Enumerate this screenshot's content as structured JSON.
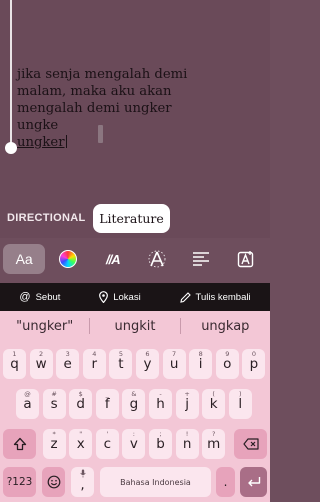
{
  "story": {
    "line1": "jika senja mengalah demi",
    "line2": "malam, maka aku akan",
    "line3": "mengalah demi ungker ungke",
    "line4": "ungker"
  },
  "styles": {
    "directional": "DIRECTIONAL",
    "literature": "Literature"
  },
  "toolbar": {
    "font_label": "Aa",
    "italic_label": "//A",
    "icons": [
      "font-icon",
      "color-wheel-icon",
      "italic-effect-icon",
      "animate-icon",
      "align-icon",
      "sticker-text-icon"
    ]
  },
  "mentions": {
    "mention": "Sebut",
    "location": "Lokasi",
    "rewrite": "Tulis kembali"
  },
  "keyboard": {
    "suggestions": [
      "\"ungker\"",
      "ungkit",
      "ungkap"
    ],
    "row1": [
      "q",
      "w",
      "e",
      "r",
      "t",
      "y",
      "u",
      "i",
      "o",
      "p"
    ],
    "row1_hints": [
      "1",
      "2",
      "3",
      "4",
      "5",
      "6",
      "7",
      "8",
      "9",
      "0"
    ],
    "row2": [
      "a",
      "s",
      "d",
      "f",
      "g",
      "h",
      "j",
      "k",
      "l"
    ],
    "row2_hints": [
      "@",
      "#",
      "$",
      "_",
      "&",
      "-",
      "+",
      "(",
      ")"
    ],
    "row3": [
      "z",
      "x",
      "c",
      "v",
      "b",
      "n",
      "m"
    ],
    "row3_hints": [
      "*",
      "\"",
      "'",
      ":",
      ";",
      "!",
      "?"
    ],
    "symbols_label": "?123",
    "comma": ",",
    "period": ".",
    "space_label": "Bahasa Indonesia",
    "shift_icon": "shift-icon",
    "backspace_icon": "backspace-icon",
    "enter_icon": "enter-icon",
    "emoji_icon": "emoji-icon",
    "mic_icon": "mic-icon"
  }
}
